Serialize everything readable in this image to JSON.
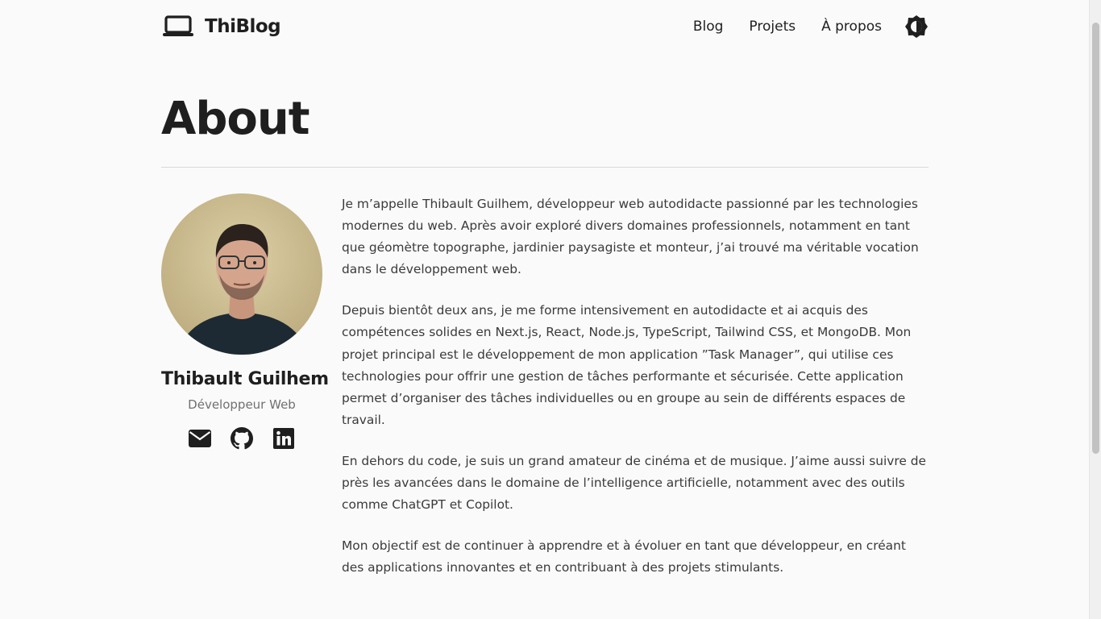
{
  "header": {
    "brand": "ThiBlog",
    "brand_icon": "laptop-icon",
    "nav": [
      {
        "label": "Blog"
      },
      {
        "label": "Projets"
      },
      {
        "label": "À propos"
      }
    ],
    "theme_icon": "theme-toggle-icon"
  },
  "page": {
    "title": "About"
  },
  "profile": {
    "name": "Thibault Guilhem",
    "role": "Développeur Web",
    "socials": [
      {
        "icon": "email-icon"
      },
      {
        "icon": "github-icon"
      },
      {
        "icon": "linkedin-icon"
      }
    ]
  },
  "bio": {
    "paragraphs": [
      "Je m’appelle Thibault Guilhem, développeur web autodidacte passionné par les technologies modernes du web. Après avoir exploré divers domaines professionnels, notamment en tant que géomètre topographe, jardinier paysagiste et monteur, j’ai trouvé ma véritable vocation dans le développement web.",
      "Depuis bientôt deux ans, je me forme intensivement en autodidacte et ai acquis des compétences solides en Next.js, React, Node.js, TypeScript, Tailwind CSS, et MongoDB. Mon projet principal est le développement de mon application ”Task Manager”, qui utilise ces technologies pour offrir une gestion de tâches performante et sécurisée. Cette application permet d’organiser des tâches individuelles ou en groupe au sein de différents espaces de travail.",
      "En dehors du code, je suis un grand amateur de cinéma et de musique. J’aime aussi suivre de près les avancées dans le domaine de l’intelligence artificielle, notamment avec des outils comme ChatGPT et Copilot.",
      "Mon objectif est de continuer à apprendre et à évoluer en tant que développeur, en créant des applications innovantes et en contribuant à des projets stimulants."
    ]
  },
  "colors": {
    "background": "#fafafa",
    "text": "#1f1f1f",
    "muted": "#707070",
    "divider": "#d8d8d8"
  }
}
